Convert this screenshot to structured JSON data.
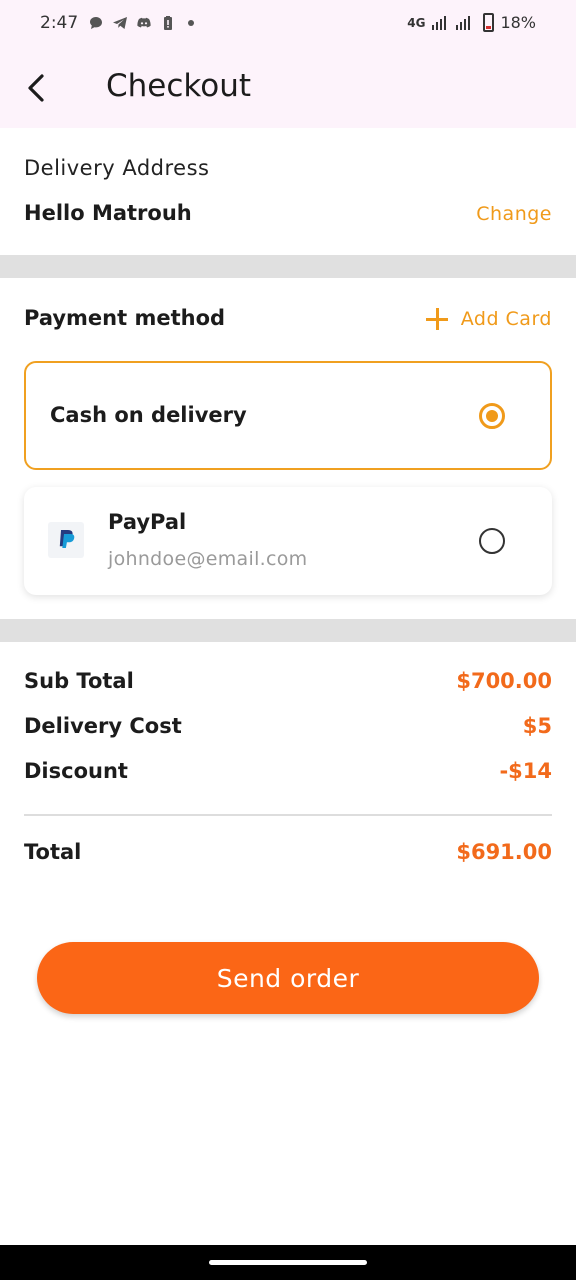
{
  "status_bar": {
    "time": "2:47",
    "network": "4G",
    "battery": "18%",
    "icons": [
      "chat-icon",
      "telegram-icon",
      "discord-icon",
      "battery-alert-icon",
      "dot-icon",
      "signal-icon",
      "signal-icon",
      "battery-icon"
    ]
  },
  "app_bar": {
    "title": "Checkout",
    "back_icon": "back-arrow-icon"
  },
  "delivery": {
    "label": "Delivery Address",
    "address": "Hello Matrouh",
    "change_label": "Change"
  },
  "payment": {
    "title": "Payment method",
    "add_card_label": "Add Card",
    "methods": [
      {
        "name": "Cash on delivery",
        "selected": true
      },
      {
        "name": "PayPal",
        "email": "johndoe@email.com",
        "selected": false
      }
    ]
  },
  "summary": {
    "sub_total_label": "Sub Total",
    "sub_total_value": "$700.00",
    "delivery_label": "Delivery Cost",
    "delivery_value": "$5",
    "discount_label": "Discount",
    "discount_value": "-$14",
    "total_label": "Total",
    "total_value": "$691.00"
  },
  "actions": {
    "send_order_label": "Send order"
  },
  "colors": {
    "accent": "#f09a1a",
    "primary_button": "#fb6616",
    "price": "#f26a1b",
    "app_bar_bg": "#fdf3fb"
  }
}
